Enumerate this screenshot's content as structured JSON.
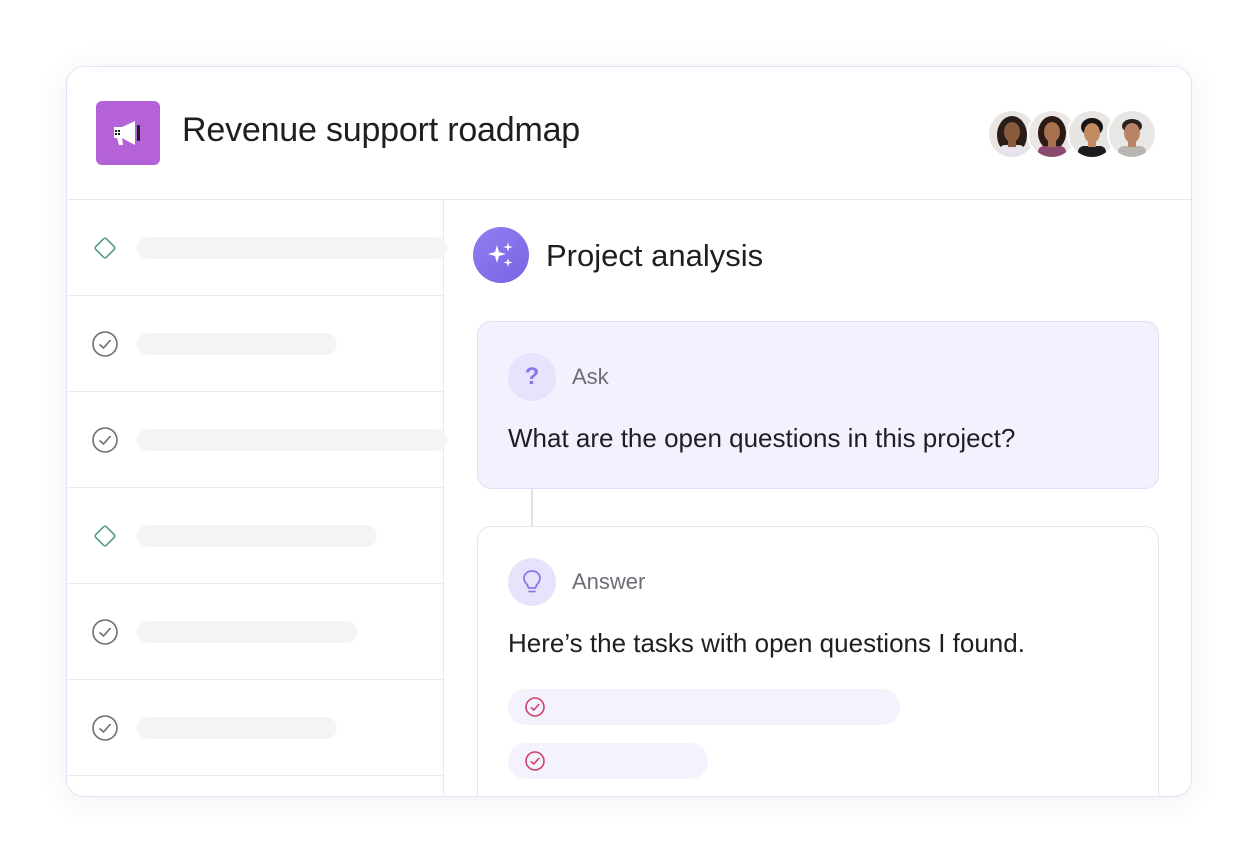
{
  "project": {
    "title": "Revenue support roadmap",
    "icon": "megaphone-icon",
    "icon_color": "#b561d8"
  },
  "members": [
    {
      "name": "avatar-1"
    },
    {
      "name": "avatar-2"
    },
    {
      "name": "avatar-3"
    },
    {
      "name": "avatar-4"
    }
  ],
  "tasks": [
    {
      "icon": "diamond-milestone-icon",
      "status": "milestone"
    },
    {
      "icon": "check-circle-icon",
      "status": "task"
    },
    {
      "icon": "check-circle-icon",
      "status": "task"
    },
    {
      "icon": "diamond-milestone-icon",
      "status": "milestone"
    },
    {
      "icon": "check-circle-icon",
      "status": "task"
    },
    {
      "icon": "check-circle-icon",
      "status": "task"
    }
  ],
  "analysis": {
    "title": "Project analysis",
    "icon": "sparkles-icon",
    "accent": "#7b63e3",
    "ask": {
      "label": "Ask",
      "icon": "question-mark-icon",
      "question_mark": "?",
      "text": "What are the open questions in this project?"
    },
    "answer": {
      "label": "Answer",
      "icon": "lightbulb-icon",
      "text": "Here’s the tasks with open questions I found.",
      "result_icon": "check-circle-icon",
      "result_icon_color": "#d33f6c"
    }
  }
}
